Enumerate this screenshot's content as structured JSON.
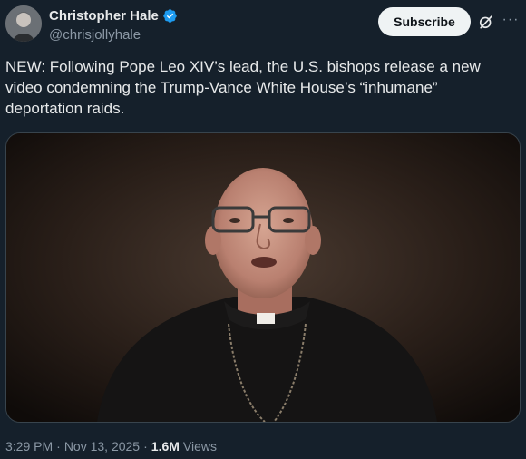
{
  "author": {
    "name": "Christopher Hale",
    "handle": "@chrisjollyhale"
  },
  "actions": {
    "subscribe_label": "Subscribe"
  },
  "tweet": {
    "text": "NEW: Following Pope Leo XIV’s lead, the U.S. bishops release a new video condemning the Trump-Vance White House’s “inhumane” deportation raids."
  },
  "meta": {
    "time": "3:29 PM",
    "date": "Nov 13, 2025",
    "separator": "·",
    "views_count": "1.6M",
    "views_label": "Views"
  },
  "colors": {
    "background": "#15202b",
    "verified": "#1d9bf0",
    "subscribe_bg": "#eff3f4"
  },
  "icons": [
    "verified-badge-icon",
    "grok-icon",
    "more-icon"
  ]
}
